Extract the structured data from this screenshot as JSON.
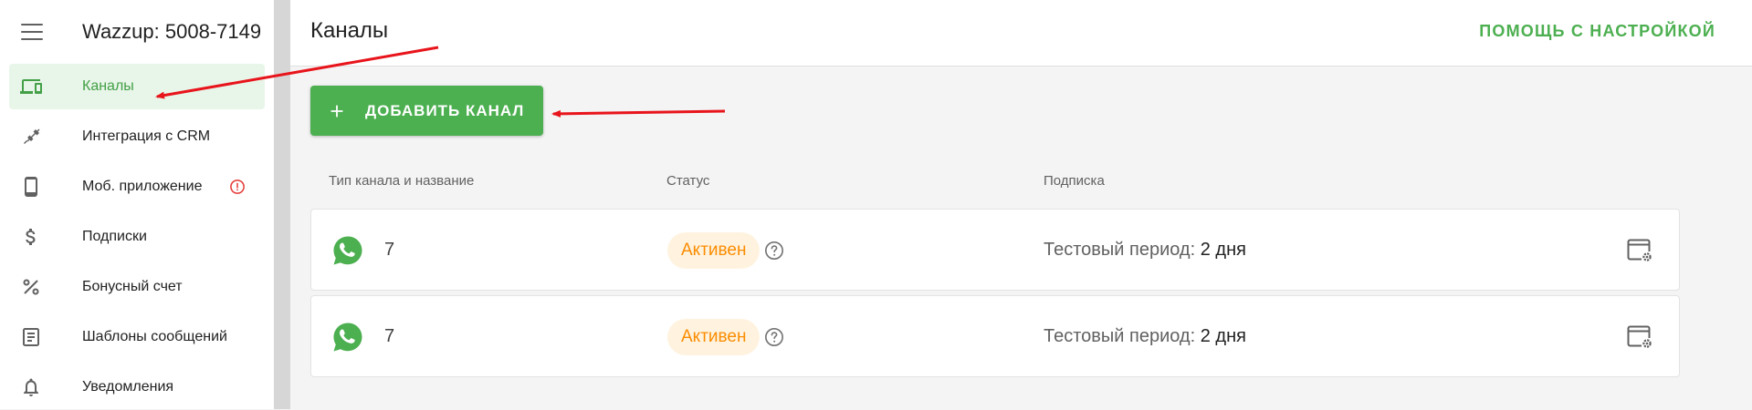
{
  "app": {
    "title": "Wazzup: 5008-7149"
  },
  "sidebar": {
    "items": [
      {
        "label": "Каналы",
        "icon": "devices-icon",
        "active": true
      },
      {
        "label": "Интеграция с CRM",
        "icon": "plug-icon"
      },
      {
        "label": "Моб. приложение",
        "icon": "phone-icon",
        "warning": true
      },
      {
        "label": "Подписки",
        "icon": "dollar-icon"
      },
      {
        "label": "Бонусный счет",
        "icon": "percent-icon"
      },
      {
        "label": "Шаблоны сообщений",
        "icon": "document-icon"
      },
      {
        "label": "Уведомления",
        "icon": "bell-icon"
      }
    ]
  },
  "header": {
    "page_title": "Каналы",
    "help_link": "ПОМОЩЬ С НАСТРОЙКОЙ"
  },
  "toolbar": {
    "add_channel_label": "ДОБАВИТЬ КАНАЛ"
  },
  "table": {
    "columns": [
      "Тип канала и название",
      "Статус",
      "Подписка"
    ],
    "rows": [
      {
        "channel_icon": "whatsapp-icon",
        "name": "7",
        "status": "Активен",
        "subscription_label": "Тестовый период:",
        "subscription_value": "2 дня"
      },
      {
        "channel_icon": "whatsapp-icon",
        "name": "7",
        "status": "Активен",
        "subscription_label": "Тестовый период:",
        "subscription_value": "2 дня"
      }
    ]
  },
  "colors": {
    "accent_green": "#4caf50",
    "active_bg": "#e8f5e9",
    "status_orange": "#fb8c00",
    "status_bg": "#fff3e0",
    "warning_red": "#e53935",
    "annotation_red": "#e8141b"
  }
}
